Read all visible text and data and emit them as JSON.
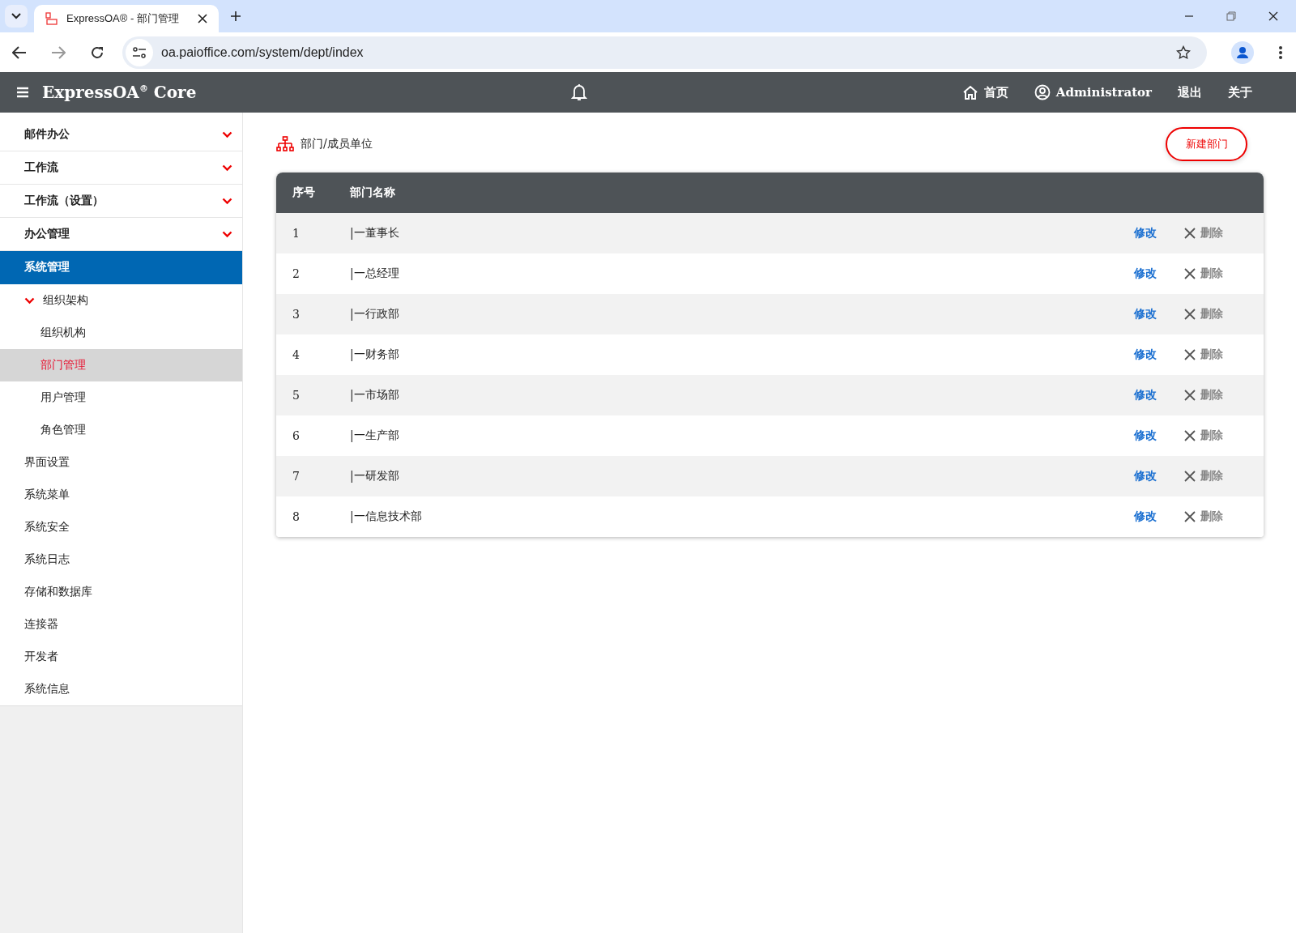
{
  "browser": {
    "tab_title": "ExpressOA® - 部门管理",
    "url": "oa.paioffice.com/system/dept/index"
  },
  "header": {
    "brand": "ExpressOA$^{®}$ Core",
    "nav": [
      {
        "kind": "home",
        "label": "首页"
      },
      {
        "kind": "user",
        "label": "Administrator"
      },
      {
        "kind": "text",
        "label": "退出"
      },
      {
        "kind": "text",
        "label": "关于"
      }
    ]
  },
  "sidebar": {
    "items": [
      {
        "label": "邮件办公",
        "kind": "group",
        "selected": false
      },
      {
        "label": "工作流",
        "kind": "group",
        "selected": false
      },
      {
        "label": "工作流（设置）",
        "kind": "group",
        "selected": false
      },
      {
        "label": "办公管理",
        "kind": "group",
        "selected": false
      },
      {
        "label": "系统管理",
        "kind": "item",
        "selected": true,
        "children": [
          {
            "label": "组织架构",
            "kind": "group",
            "expanded": true,
            "children": [
              {
                "label": "组织机构",
                "selected": false
              },
              {
                "label": "部门管理",
                "selected": true
              },
              {
                "label": "用户管理",
                "selected": false
              },
              {
                "label": "角色管理",
                "selected": false
              }
            ]
          },
          {
            "label": "界面设置",
            "kind": "item",
            "selected": false
          },
          {
            "label": "系统菜单",
            "kind": "item",
            "selected": false
          },
          {
            "label": "系统安全",
            "kind": "item",
            "selected": false
          },
          {
            "label": "系统日志",
            "kind": "item",
            "selected": false
          },
          {
            "label": "存储和数据库",
            "kind": "item",
            "selected": false
          },
          {
            "label": "连接器",
            "kind": "item",
            "selected": false
          },
          {
            "label": "开发者",
            "kind": "item",
            "selected": false
          },
          {
            "label": "系统信息",
            "kind": "item",
            "selected": false
          }
        ]
      }
    ]
  },
  "page": {
    "title": "部门/成员单位",
    "new_button": "新建部门"
  },
  "table": {
    "columns": [
      "序号",
      "部门名称"
    ],
    "rows": [
      {
        "index": "1",
        "name": "|一董事长",
        "edit": "修改",
        "delete": "删除"
      },
      {
        "index": "2",
        "name": "|一总经理",
        "edit": "修改",
        "delete": "删除"
      },
      {
        "index": "3",
        "name": "|一行政部",
        "edit": "修改",
        "delete": "删除"
      },
      {
        "index": "4",
        "name": "|一财务部",
        "edit": "修改",
        "delete": "删除"
      },
      {
        "index": "5",
        "name": "|一市场部",
        "edit": "修改",
        "delete": "删除"
      },
      {
        "index": "6",
        "name": "|一生产部",
        "edit": "修改",
        "delete": "删除"
      },
      {
        "index": "7",
        "name": "|一研发部",
        "edit": "修改",
        "delete": "删除"
      },
      {
        "index": "8",
        "name": "|一信息技术部",
        "edit": "修改",
        "delete": "删除"
      }
    ]
  }
}
